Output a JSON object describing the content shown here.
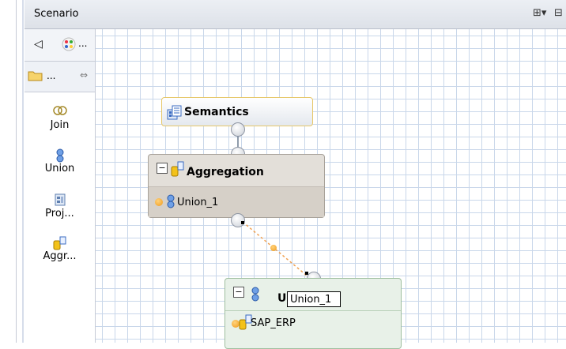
{
  "header": {
    "title": "Scenario",
    "expand_all_label": "⊞▾",
    "collapse_all_label": "⊟"
  },
  "palette": {
    "back_label": "◁",
    "more_label": "...",
    "folder_more_label": "...",
    "items": [
      {
        "label": "Join",
        "icon": "join-icon"
      },
      {
        "label": "Union",
        "icon": "union-icon"
      },
      {
        "label": "Proj...",
        "icon": "projection-icon"
      },
      {
        "label": "Aggr...",
        "icon": "aggregation-icon"
      }
    ]
  },
  "nodes": {
    "semantics": {
      "label": "Semantics"
    },
    "aggregation": {
      "label": "Aggregation",
      "inputs": [
        {
          "label": "Union_1"
        }
      ]
    },
    "union": {
      "label_prefix": "U",
      "edit_value": "Union_1",
      "inputs": [
        {
          "label": "SAP_ERP"
        }
      ]
    }
  },
  "colors": {
    "grid": "#c9d7ea",
    "semantics_border": "#e7c86a",
    "aggregation_bg": "#e3dfd9",
    "union_bg": "#e8f1e8",
    "edge": "#f0a050"
  }
}
